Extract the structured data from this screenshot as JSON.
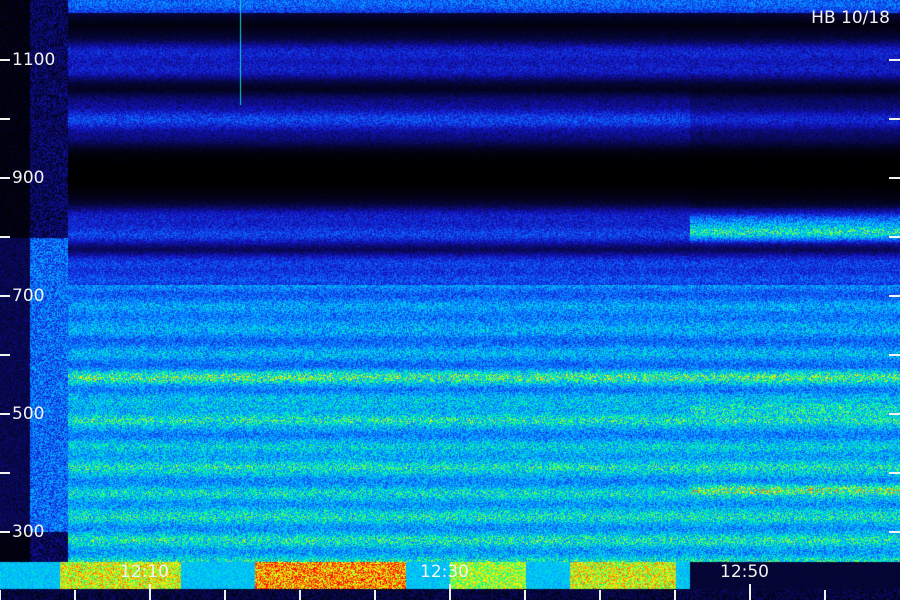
{
  "chart_data": {
    "type": "heatmap",
    "title": "HB 10/18",
    "xlabel": "",
    "ylabel": "",
    "y_axis": {
      "ylim": [
        250,
        1240
      ],
      "labeled_ticks": [
        300,
        500,
        700,
        900,
        1100
      ],
      "minor_ticks": [
        400,
        600,
        800,
        1000
      ]
    },
    "x_axis": {
      "xlim_minutes_after_12_00": [
        -2,
        58
      ],
      "tick_labels": [
        "12:10",
        "12:30",
        "12:50"
      ],
      "tick_values_minutes": [
        10,
        30,
        50
      ],
      "minor_tick_values_minutes": [
        0,
        5,
        15,
        20,
        25,
        35,
        40,
        45,
        55
      ]
    },
    "colormap": [
      "#000000",
      "#1414c8",
      "#0a6eff",
      "#00c8ff",
      "#00ff8c",
      "#ffff00",
      "#ff0000"
    ],
    "bands_y": [
      {
        "y": 1225,
        "intensity": 0.45
      },
      {
        "y": 1100,
        "intensity": 0.25
      },
      {
        "y": 1000,
        "intensity": 0.28
      },
      {
        "y": 815,
        "intensity": 0.3
      },
      {
        "y": 740,
        "intensity": 0.35
      },
      {
        "y": 660,
        "intensity": 0.55
      },
      {
        "y": 560,
        "intensity": 0.7
      },
      {
        "y": 500,
        "intensity": 0.72
      },
      {
        "y": 420,
        "intensity": 0.7
      },
      {
        "y": 340,
        "intensity": 0.65
      }
    ],
    "regime_change_minute": 46,
    "late_features": [
      {
        "y": 815,
        "intensity": 0.75
      },
      {
        "y": 505,
        "intensity": 0.85
      },
      {
        "y": 375,
        "intensity": 0.8
      }
    ],
    "hot_strip": [
      {
        "x_from": 4,
        "x_to": 12,
        "intensity": 0.9
      },
      {
        "x_from": 17,
        "x_to": 27,
        "intensity": 1.0
      },
      {
        "x_from": 30,
        "x_to": 35,
        "intensity": 0.85
      },
      {
        "x_from": 38,
        "x_to": 45,
        "intensity": 0.9
      }
    ],
    "spike_minute": 16
  }
}
